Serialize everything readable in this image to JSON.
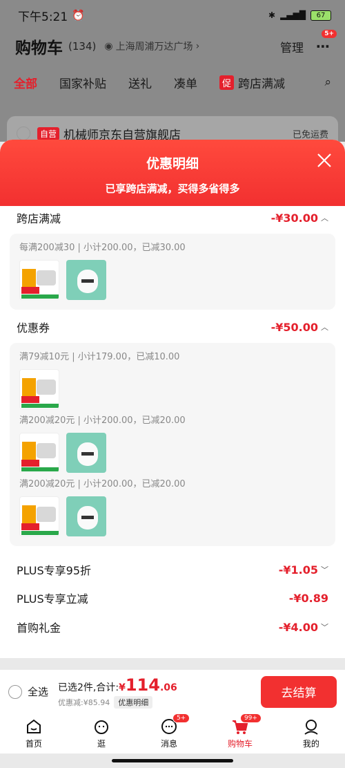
{
  "status": {
    "time": "下午5:21",
    "battery": "67"
  },
  "header": {
    "title": "购物车",
    "count": "(134)",
    "location": "上海周浦万达广场",
    "manage": "管理",
    "badge": "5+"
  },
  "tabs": [
    "全部",
    "国家补贴",
    "送礼",
    "凑单"
  ],
  "promo_tab": {
    "tag": "促",
    "label": "跨店满减"
  },
  "store": {
    "tag": "自营",
    "name": "机械师京东自营旗舰店",
    "free_shipping": "已免运费"
  },
  "sheet": {
    "title": "优惠明细",
    "subtitle": "已享跨店满减，买得多省得多",
    "cross_store": {
      "label": "跨店满减",
      "amount": "-¥30.00",
      "desc": "每满200减30 | 小计200.00，已减30.00"
    },
    "coupon": {
      "label": "优惠券",
      "amount": "-¥50.00",
      "items": [
        {
          "desc": "满79减10元 | 小计179.00，已减10.00"
        },
        {
          "desc": "满200减20元 | 小计200.00，已减20.00"
        },
        {
          "desc": "满200减20元 | 小计200.00，已减20.00"
        }
      ]
    },
    "plus95": {
      "label": "PLUS专享95折",
      "amount": "-¥1.05"
    },
    "plus_cut": {
      "label": "PLUS专享立减",
      "amount": "-¥0.89"
    },
    "first_gift": {
      "label": "首购礼金",
      "amount": "-¥4.00"
    }
  },
  "footer": {
    "select_all": "全选",
    "selected": "已选2件,合计:",
    "currency": "¥",
    "total_int": "114",
    "total_dec": ".06",
    "discount": "优惠减:¥85.94",
    "detail_btn": "优惠明细",
    "checkout": "去结算"
  },
  "nav": [
    {
      "label": "首页"
    },
    {
      "label": "逛"
    },
    {
      "label": "消息",
      "badge": "5+"
    },
    {
      "label": "购物车",
      "badge": "99+"
    },
    {
      "label": "我的"
    }
  ],
  "colors": {
    "accent": "#e4202c"
  }
}
